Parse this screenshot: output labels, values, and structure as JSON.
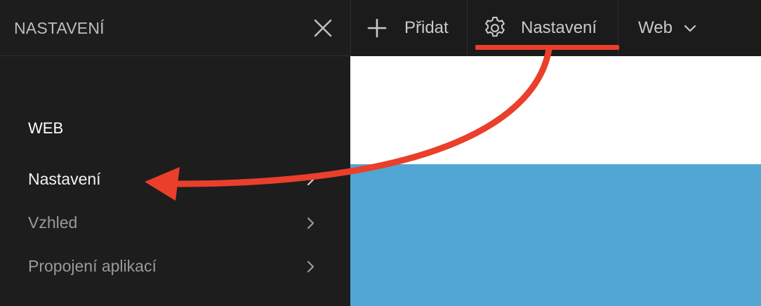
{
  "panel": {
    "title": "NASTAVENÍ",
    "section_heading": "WEB",
    "items": [
      {
        "label": "Nastavení",
        "active": true
      },
      {
        "label": "Vzhled",
        "active": false
      },
      {
        "label": "Propojení aplikací",
        "active": false
      }
    ]
  },
  "toolbar": {
    "add_label": "Přidat",
    "settings_label": "Nastavení",
    "site_label": "Web"
  },
  "colors": {
    "annotation": "#ea3f2a",
    "preview_top": "#ffffff",
    "preview_bottom": "#52a6d3",
    "panel_bg": "#1d1d1d"
  },
  "icons": [
    "close-icon",
    "plus-icon",
    "gear-icon",
    "chevron-down-icon",
    "chevron-right-icon"
  ]
}
